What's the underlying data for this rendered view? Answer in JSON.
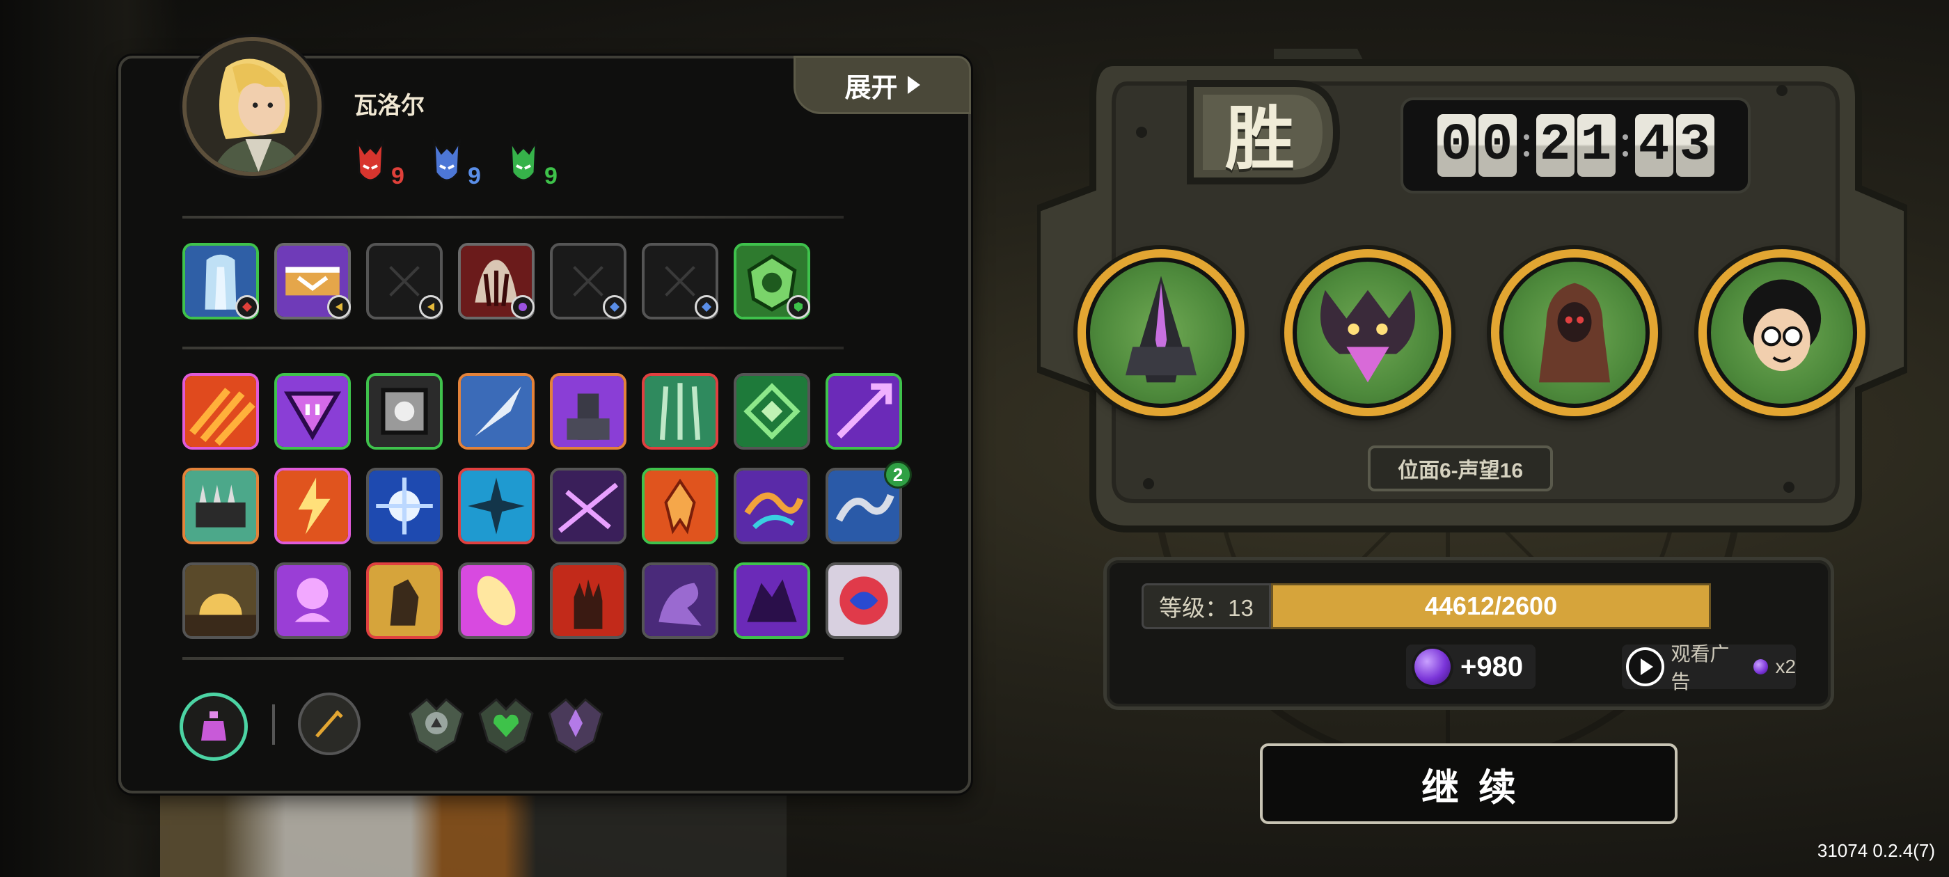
{
  "hero": {
    "name": "瓦洛尔",
    "elements": [
      {
        "icon": "red-mask-icon",
        "value": "9",
        "color": "#e0403a"
      },
      {
        "icon": "blue-mask-icon",
        "value": "9",
        "color": "#5a8ee8"
      },
      {
        "icon": "green-mask-icon",
        "value": "9",
        "color": "#3ec24a"
      }
    ]
  },
  "expand_button": {
    "label": "展开"
  },
  "equipment_slots": [
    {
      "name": "waterfall-item",
      "state": "filled"
    },
    {
      "name": "purple-chest-item",
      "state": "filled"
    },
    {
      "name": "empty-slot",
      "state": "empty"
    },
    {
      "name": "claw-item",
      "state": "filled"
    },
    {
      "name": "empty-slot",
      "state": "empty"
    },
    {
      "name": "empty-slot",
      "state": "empty"
    },
    {
      "name": "green-shield-item",
      "state": "filled"
    }
  ],
  "skills_badge": "2",
  "victory_label": "胜",
  "timer": {
    "hours": "00",
    "minutes": "21",
    "seconds": "43"
  },
  "bosses": [
    "dark-crystal-boss",
    "horned-beast-boss",
    "hooded-brute-boss",
    "curly-hair-boss"
  ],
  "stage_label": "位面6-声望16",
  "level": {
    "label": "等级：13",
    "xp_text": "44612/2600",
    "xp_fill": 1.0
  },
  "reward": {
    "text": "+980"
  },
  "ad_button": {
    "label": "观看广告",
    "multiplier": "x2"
  },
  "continue_button": {
    "label": "继续"
  },
  "version": "31074 0.2.4(7)",
  "colors": {
    "accent": "#d6a43b",
    "panel": "#0f0f0e",
    "boss_ring": "#e3a632",
    "boss_bg": "#4e8a3c"
  }
}
